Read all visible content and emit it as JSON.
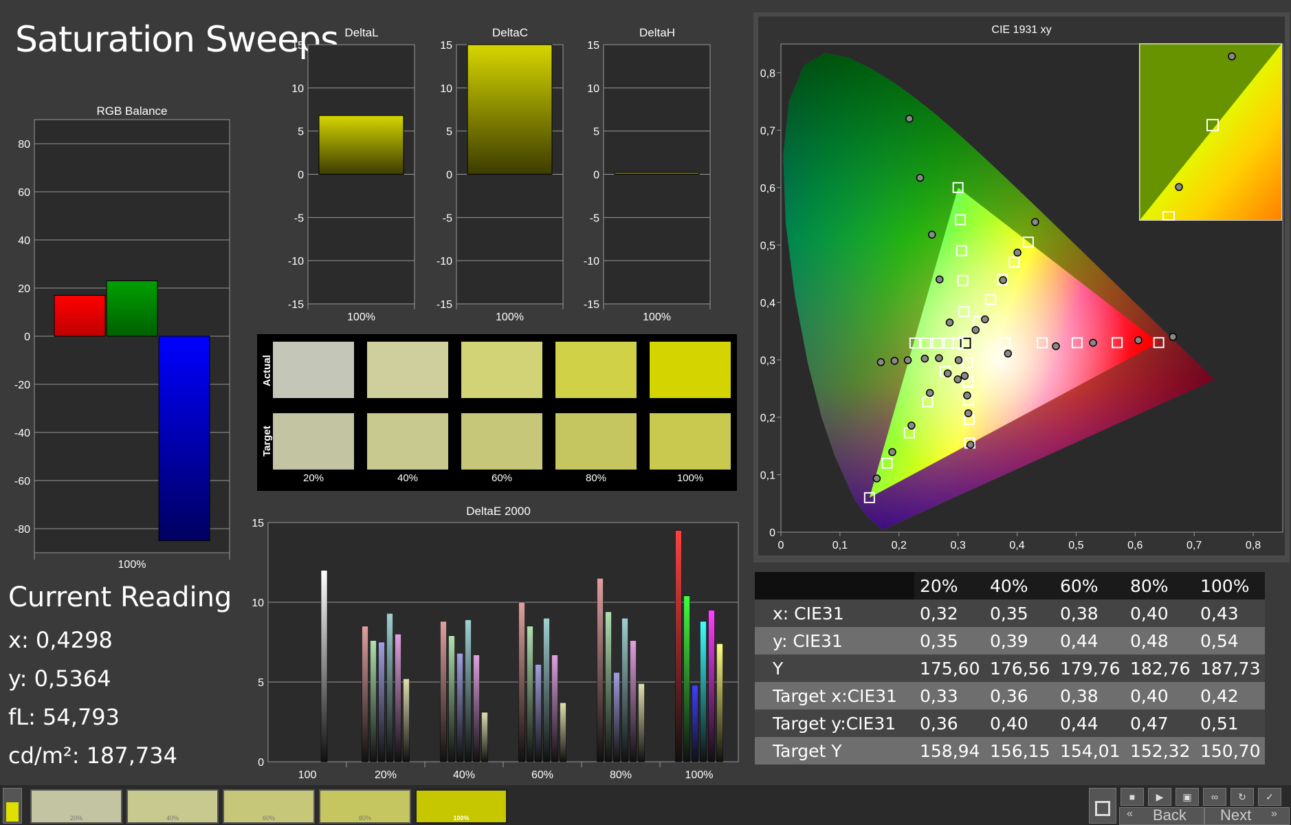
{
  "page_title": "Saturation Sweeps",
  "reading": {
    "title": "Current Reading",
    "x": "x: 0,4298",
    "y": "y: 0,5364",
    "fl": "fL: 54,793",
    "cd": "cd/m²: 187,734"
  },
  "colors": {
    "red": "#ff0000",
    "green": "#00a000",
    "blue": "#0000ff",
    "yellow_target": "#c8c800"
  },
  "chart_data": [
    {
      "id": "rgb-balance",
      "type": "bar",
      "title": "RGB Balance",
      "categories": [
        "100%"
      ],
      "series": [
        {
          "values": [
            17
          ]
        },
        {
          "values": [
            23
          ]
        },
        {
          "values": [
            -85
          ]
        }
      ],
      "ylim": [
        -90,
        90
      ],
      "yticks": [
        80,
        60,
        40,
        20,
        0,
        -20,
        -40,
        -60,
        -80
      ]
    },
    {
      "id": "delta-l",
      "type": "bar",
      "title": "DeltaL",
      "categories": [
        "100%"
      ],
      "values": [
        6.8
      ],
      "ylim": [
        -15,
        15
      ],
      "yticks": [
        15,
        10,
        5,
        0,
        -5,
        -10,
        -15
      ]
    },
    {
      "id": "delta-c",
      "type": "bar",
      "title": "DeltaC",
      "categories": [
        "100%"
      ],
      "values": [
        15.5
      ],
      "ylim": [
        -15,
        15
      ],
      "yticks": [
        15,
        10,
        5,
        0,
        -5,
        -10,
        -15
      ]
    },
    {
      "id": "delta-h",
      "type": "bar",
      "title": "DeltaH",
      "categories": [
        "100%"
      ],
      "values": [
        0.2
      ],
      "ylim": [
        -15,
        15
      ],
      "yticks": [
        15,
        10,
        5,
        0,
        -5,
        -10,
        -15
      ]
    },
    {
      "id": "delta-e",
      "type": "bar",
      "title": "DeltaE 2000",
      "categories": [
        "100",
        "20%",
        "40%",
        "60%",
        "80%",
        "100%"
      ],
      "series": [
        {
          "values": [
            12.0,
            8.5,
            8.8,
            10.0,
            11.5,
            14.5
          ]
        },
        {
          "values": [
            null,
            7.6,
            7.9,
            8.5,
            9.4,
            10.4
          ]
        },
        {
          "values": [
            null,
            7.5,
            6.8,
            6.1,
            5.6,
            4.8
          ]
        },
        {
          "values": [
            null,
            9.3,
            8.9,
            9.0,
            9.0,
            8.8
          ]
        },
        {
          "values": [
            null,
            8.0,
            6.7,
            6.7,
            7.6,
            9.5
          ]
        },
        {
          "values": [
            null,
            5.2,
            3.1,
            3.7,
            4.9,
            7.4
          ]
        }
      ],
      "ylim": [
        0,
        15
      ],
      "yticks": [
        15,
        10,
        5,
        0
      ]
    },
    {
      "id": "cie",
      "type": "scatter",
      "title": "CIE 1931 xy",
      "xlim": [
        0,
        0.85
      ],
      "ylim": [
        0,
        0.85
      ],
      "xticks": [
        "0",
        "0,1",
        "0,2",
        "0,3",
        "0,4",
        "0,5",
        "0,6",
        "0,7",
        "0,8"
      ],
      "yticks": [
        "0",
        "0,1",
        "0,2",
        "0,3",
        "0,4",
        "0,5",
        "0,6",
        "0,7",
        "0,8"
      ],
      "gamut": [
        [
          0.64,
          0.33
        ],
        [
          0.3,
          0.6
        ],
        [
          0.15,
          0.06
        ]
      ],
      "targets": [
        [
          0.3127,
          0.329
        ],
        [
          0.3,
          0.6
        ],
        [
          0.304,
          0.544
        ],
        [
          0.306,
          0.49
        ],
        [
          0.308,
          0.438
        ],
        [
          0.31,
          0.384
        ],
        [
          0.64,
          0.33
        ],
        [
          0.5695,
          0.3299
        ],
        [
          0.5017,
          0.3298
        ],
        [
          0.4426,
          0.3296
        ],
        [
          0.3795,
          0.3294
        ],
        [
          0.15,
          0.06
        ],
        [
          0.18,
          0.12
        ],
        [
          0.2176,
          0.1728
        ],
        [
          0.2486,
          0.2268
        ],
        [
          0.2785,
          0.2795
        ],
        [
          0.2269,
          0.3293
        ],
        [
          0.2455,
          0.3292
        ],
        [
          0.265,
          0.3291
        ],
        [
          0.2845,
          0.329
        ],
        [
          0.3,
          0.329
        ],
        [
          0.32,
          0.155
        ],
        [
          0.319,
          0.196
        ],
        [
          0.318,
          0.23
        ],
        [
          0.317,
          0.262
        ],
        [
          0.316,
          0.295
        ],
        [
          0.335,
          0.367
        ],
        [
          0.355,
          0.405
        ],
        [
          0.375,
          0.44
        ],
        [
          0.395,
          0.47
        ],
        [
          0.419,
          0.505
        ]
      ],
      "measured": [
        [
          0.2176,
          0.72
        ],
        [
          0.2358,
          0.617
        ],
        [
          0.2558,
          0.518
        ],
        [
          0.2687,
          0.44
        ],
        [
          0.2858,
          0.365
        ],
        [
          0.664,
          0.34
        ],
        [
          0.6053,
          0.3342
        ],
        [
          0.5287,
          0.3297
        ],
        [
          0.4658,
          0.3237
        ],
        [
          0.3846,
          0.3109
        ],
        [
          0.1623,
          0.0934
        ],
        [
          0.1886,
          0.1394
        ],
        [
          0.2211,
          0.1855
        ],
        [
          0.2523,
          0.2425
        ],
        [
          0.2825,
          0.2764
        ],
        [
          0.1693,
          0.296
        ],
        [
          0.1925,
          0.2983
        ],
        [
          0.2149,
          0.2994
        ],
        [
          0.2437,
          0.3022
        ],
        [
          0.2677,
          0.303
        ],
        [
          0.3298,
          0.352
        ],
        [
          0.3174,
          0.207
        ],
        [
          0.3154,
          0.238
        ],
        [
          0.3113,
          0.272
        ],
        [
          0.301,
          0.2995
        ],
        [
          0.2995,
          0.266
        ],
        [
          0.321,
          0.152
        ],
        [
          0.3456,
          0.3706
        ],
        [
          0.3763,
          0.4388
        ],
        [
          0.4007,
          0.4868
        ],
        [
          0.4306,
          0.54
        ]
      ]
    }
  ],
  "swatches": {
    "actual_label": "Actual",
    "target_label": "Target",
    "labels": [
      "20%",
      "40%",
      "60%",
      "80%",
      "100%"
    ],
    "actual": [
      "#c4c7b8",
      "#cfcf9d",
      "#d2d277",
      "#d1d147",
      "#d3d400"
    ],
    "target": [
      "#c3c4a2",
      "#c7c98f",
      "#c7c77a",
      "#c6c661",
      "#c9c950"
    ]
  },
  "table": {
    "headers": [
      "",
      "20%",
      "40%",
      "60%",
      "80%",
      "100%"
    ],
    "rows": [
      [
        "x: CIE31",
        "0,32",
        "0,35",
        "0,38",
        "0,40",
        "0,43"
      ],
      [
        "y: CIE31",
        "0,35",
        "0,39",
        "0,44",
        "0,48",
        "0,54"
      ],
      [
        "Y",
        "175,60",
        "176,56",
        "179,76",
        "182,76",
        "187,73"
      ],
      [
        "Target x:CIE31",
        "0,33",
        "0,36",
        "0,38",
        "0,40",
        "0,42"
      ],
      [
        "Target y:CIE31",
        "0,36",
        "0,40",
        "0,44",
        "0,47",
        "0,51"
      ],
      [
        "Target Y",
        "158,94",
        "156,15",
        "154,01",
        "152,32",
        "150,70"
      ]
    ]
  },
  "taskbar": {
    "thumbs": [
      "20%",
      "40%",
      "60%",
      "80%",
      "100%"
    ],
    "thumb_colors": [
      "#c3c4a2",
      "#c7c98f",
      "#c7c77a",
      "#c6c661",
      "#c7c700"
    ],
    "back_label": "Back",
    "next_label": "Next"
  }
}
